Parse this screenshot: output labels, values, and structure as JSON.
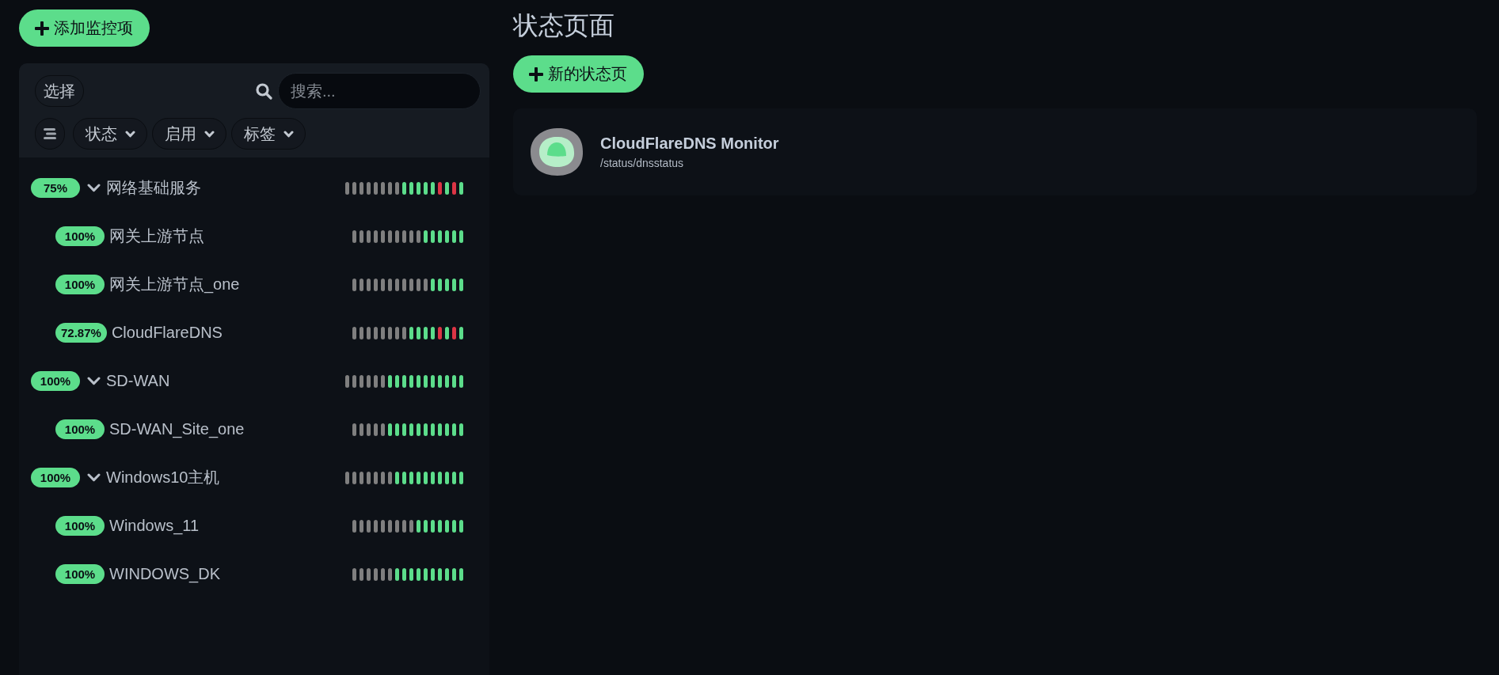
{
  "add_button": {
    "label": "添加监控项"
  },
  "monitor_list": {
    "select_button": "选择",
    "search": {
      "placeholder": "搜索..."
    },
    "filters": [
      "状态",
      "启用",
      "标签"
    ],
    "monitors": [
      {
        "uptime": "75%",
        "name": "网络基础服务",
        "expanded": true,
        "beats": [
          {
            "kind": "empty"
          },
          {
            "kind": "empty"
          },
          {
            "kind": "empty"
          },
          {
            "kind": "empty"
          },
          {
            "kind": "empty"
          },
          {
            "kind": "empty"
          },
          {
            "kind": "empty"
          },
          {
            "kind": "empty"
          },
          {
            "kind": "up"
          },
          {
            "kind": "up"
          },
          {
            "kind": "up"
          },
          {
            "kind": "up"
          },
          {
            "kind": "up"
          },
          {
            "kind": "down"
          },
          {
            "kind": "up"
          },
          {
            "kind": "down"
          },
          {
            "kind": "up"
          }
        ],
        "children": [
          {
            "uptime": "100%",
            "name": "网关上游节点",
            "beats": [
              {
                "kind": "empty"
              },
              {
                "kind": "empty"
              },
              {
                "kind": "empty"
              },
              {
                "kind": "empty"
              },
              {
                "kind": "empty"
              },
              {
                "kind": "empty"
              },
              {
                "kind": "empty"
              },
              {
                "kind": "empty"
              },
              {
                "kind": "empty"
              },
              {
                "kind": "empty"
              },
              {
                "kind": "up"
              },
              {
                "kind": "up"
              },
              {
                "kind": "up"
              },
              {
                "kind": "up"
              },
              {
                "kind": "up"
              },
              {
                "kind": "up"
              }
            ]
          },
          {
            "uptime": "100%",
            "name": "网关上游节点_one",
            "beats": [
              {
                "kind": "empty"
              },
              {
                "kind": "empty"
              },
              {
                "kind": "empty"
              },
              {
                "kind": "empty"
              },
              {
                "kind": "empty"
              },
              {
                "kind": "empty"
              },
              {
                "kind": "empty"
              },
              {
                "kind": "empty"
              },
              {
                "kind": "empty"
              },
              {
                "kind": "empty"
              },
              {
                "kind": "empty"
              },
              {
                "kind": "up"
              },
              {
                "kind": "up"
              },
              {
                "kind": "up"
              },
              {
                "kind": "up"
              },
              {
                "kind": "up"
              }
            ]
          },
          {
            "uptime": "72.87%",
            "name": "CloudFlareDNS",
            "beats": [
              {
                "kind": "empty"
              },
              {
                "kind": "empty"
              },
              {
                "kind": "empty"
              },
              {
                "kind": "empty"
              },
              {
                "kind": "empty"
              },
              {
                "kind": "empty"
              },
              {
                "kind": "empty"
              },
              {
                "kind": "empty"
              },
              {
                "kind": "up"
              },
              {
                "kind": "up"
              },
              {
                "kind": "up"
              },
              {
                "kind": "up"
              },
              {
                "kind": "down"
              },
              {
                "kind": "up"
              },
              {
                "kind": "down"
              },
              {
                "kind": "up"
              }
            ]
          }
        ]
      },
      {
        "uptime": "100%",
        "name": "SD-WAN",
        "expanded": true,
        "beats": [
          {
            "kind": "empty"
          },
          {
            "kind": "empty"
          },
          {
            "kind": "empty"
          },
          {
            "kind": "empty"
          },
          {
            "kind": "empty"
          },
          {
            "kind": "empty"
          },
          {
            "kind": "up"
          },
          {
            "kind": "up"
          },
          {
            "kind": "up"
          },
          {
            "kind": "up"
          },
          {
            "kind": "up"
          },
          {
            "kind": "up"
          },
          {
            "kind": "up"
          },
          {
            "kind": "up"
          },
          {
            "kind": "up"
          },
          {
            "kind": "up"
          },
          {
            "kind": "up"
          }
        ],
        "children": [
          {
            "uptime": "100%",
            "name": "SD-WAN_Site_one",
            "beats": [
              {
                "kind": "empty"
              },
              {
                "kind": "empty"
              },
              {
                "kind": "empty"
              },
              {
                "kind": "empty"
              },
              {
                "kind": "empty"
              },
              {
                "kind": "up"
              },
              {
                "kind": "up"
              },
              {
                "kind": "up"
              },
              {
                "kind": "up"
              },
              {
                "kind": "up"
              },
              {
                "kind": "up"
              },
              {
                "kind": "up"
              },
              {
                "kind": "up"
              },
              {
                "kind": "up"
              },
              {
                "kind": "up"
              },
              {
                "kind": "up"
              }
            ]
          }
        ]
      },
      {
        "uptime": "100%",
        "name": "Windows10主机",
        "expanded": true,
        "beats": [
          {
            "kind": "empty"
          },
          {
            "kind": "empty"
          },
          {
            "kind": "empty"
          },
          {
            "kind": "empty"
          },
          {
            "kind": "empty"
          },
          {
            "kind": "empty"
          },
          {
            "kind": "empty"
          },
          {
            "kind": "up"
          },
          {
            "kind": "up"
          },
          {
            "kind": "up"
          },
          {
            "kind": "up"
          },
          {
            "kind": "up"
          },
          {
            "kind": "up"
          },
          {
            "kind": "up"
          },
          {
            "kind": "up"
          },
          {
            "kind": "up"
          },
          {
            "kind": "up"
          }
        ],
        "children": [
          {
            "uptime": "100%",
            "name": "Windows_11",
            "beats": [
              {
                "kind": "empty"
              },
              {
                "kind": "empty"
              },
              {
                "kind": "empty"
              },
              {
                "kind": "empty"
              },
              {
                "kind": "empty"
              },
              {
                "kind": "empty"
              },
              {
                "kind": "empty"
              },
              {
                "kind": "empty"
              },
              {
                "kind": "empty"
              },
              {
                "kind": "up"
              },
              {
                "kind": "up"
              },
              {
                "kind": "up"
              },
              {
                "kind": "up"
              },
              {
                "kind": "up"
              },
              {
                "kind": "up"
              },
              {
                "kind": "up"
              }
            ]
          },
          {
            "uptime": "100%",
            "name": "WINDOWS_DK",
            "beats": [
              {
                "kind": "empty"
              },
              {
                "kind": "empty"
              },
              {
                "kind": "empty"
              },
              {
                "kind": "empty"
              },
              {
                "kind": "empty"
              },
              {
                "kind": "empty"
              },
              {
                "kind": "up"
              },
              {
                "kind": "up"
              },
              {
                "kind": "up"
              },
              {
                "kind": "up"
              },
              {
                "kind": "up"
              },
              {
                "kind": "up"
              },
              {
                "kind": "up"
              },
              {
                "kind": "up"
              },
              {
                "kind": "up"
              },
              {
                "kind": "up"
              }
            ]
          }
        ]
      }
    ]
  },
  "status_pages": {
    "title": "状态页面",
    "new_button": "新的状态页",
    "pages": [
      {
        "title": "CloudFlareDNS Monitor",
        "slug": "/status/dnsstatus"
      }
    ]
  }
}
